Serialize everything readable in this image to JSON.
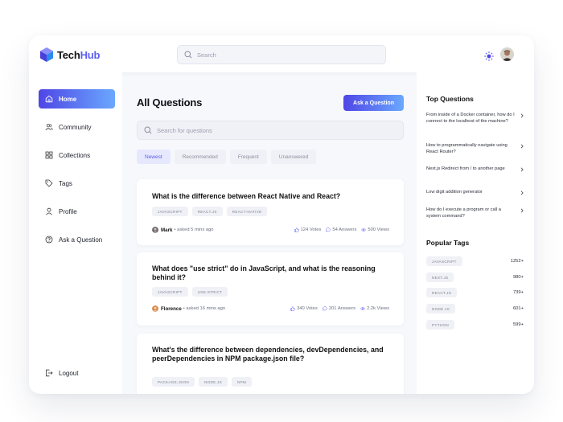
{
  "brand": {
    "name_main": "Tech",
    "name_accent": "Hub",
    "accent_color": "#5b5ef0"
  },
  "topbar": {
    "search_placeholder": "Search"
  },
  "sidebar": {
    "items": [
      {
        "label": "Home",
        "icon": "home-icon"
      },
      {
        "label": "Community",
        "icon": "users-icon"
      },
      {
        "label": "Collections",
        "icon": "grid-icon"
      },
      {
        "label": "Tags",
        "icon": "tag-icon"
      },
      {
        "label": "Profile",
        "icon": "user-icon"
      },
      {
        "label": "Ask a Question",
        "icon": "help-icon"
      }
    ],
    "logout_label": "Logout"
  },
  "main": {
    "title": "All Questions",
    "ask_button": "Ask a Question",
    "search_placeholder": "Search for questions",
    "filters": [
      "Newest",
      "Recommended",
      "Frequent",
      "Unanswered"
    ],
    "questions": [
      {
        "title": "What is the difference between React Native and React?",
        "tags": [
          "JAVASCRIPT",
          "REACT.JS",
          "REACT-NATIVE"
        ],
        "author": "Mark",
        "asked": "• asked 5 mins ago",
        "votes": "124 Votes",
        "answers": "54 Answers",
        "views": "500 Views"
      },
      {
        "title": "What does \"use strict\" do in JavaScript, and what is the reasoning behind it?",
        "tags": [
          "JAVASCRIPT",
          "USE-STRICT"
        ],
        "author": "Florence",
        "asked": "• asked 16 mins ago",
        "votes": "340 Votes",
        "answers": "201 Answers",
        "views": "2.2k Views"
      },
      {
        "title": "What's the difference between dependencies, devDependencies, and peerDependencies in NPM package.json file?",
        "tags": [
          "PACKAGE.JSON",
          "NODE.JS",
          "NPM"
        ]
      }
    ]
  },
  "rightbar": {
    "top_title": "Top Questions",
    "top_questions": [
      "From inside of a Docker container, how do I connect to the localhost of the machine?",
      "How to programmatically navigate using React Router?",
      "Next.js Redirect from / to another page",
      "Low digit addition generator",
      "How do I execute a program or call a system command?"
    ],
    "tags_title": "Popular Tags",
    "popular_tags": [
      {
        "name": "JAVASCRIPT",
        "count": "1252+"
      },
      {
        "name": "NEXT.JS",
        "count": "980+"
      },
      {
        "name": "REACT.JS",
        "count": "739+"
      },
      {
        "name": "NODE.JS",
        "count": "601+"
      },
      {
        "name": "PYTHON",
        "count": "599+"
      }
    ]
  }
}
